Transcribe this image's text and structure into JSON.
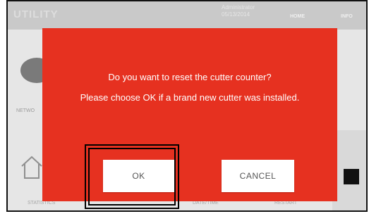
{
  "header": {
    "title": "UTILITY",
    "user": "Administrator",
    "date": "05/13/2014",
    "nav_home": "HOME",
    "nav_info": "INFO"
  },
  "background": {
    "network_label": "NETWO",
    "bottom_labels": [
      "STATISTICS",
      "DATE/TIME",
      "RESTART"
    ]
  },
  "dialog": {
    "message_line1": "Do you want to reset the cutter counter?",
    "message_line2": "Please choose OK if a brand new cutter was installed.",
    "ok_label": "OK",
    "cancel_label": "CANCEL",
    "background_color": "#e63120"
  }
}
